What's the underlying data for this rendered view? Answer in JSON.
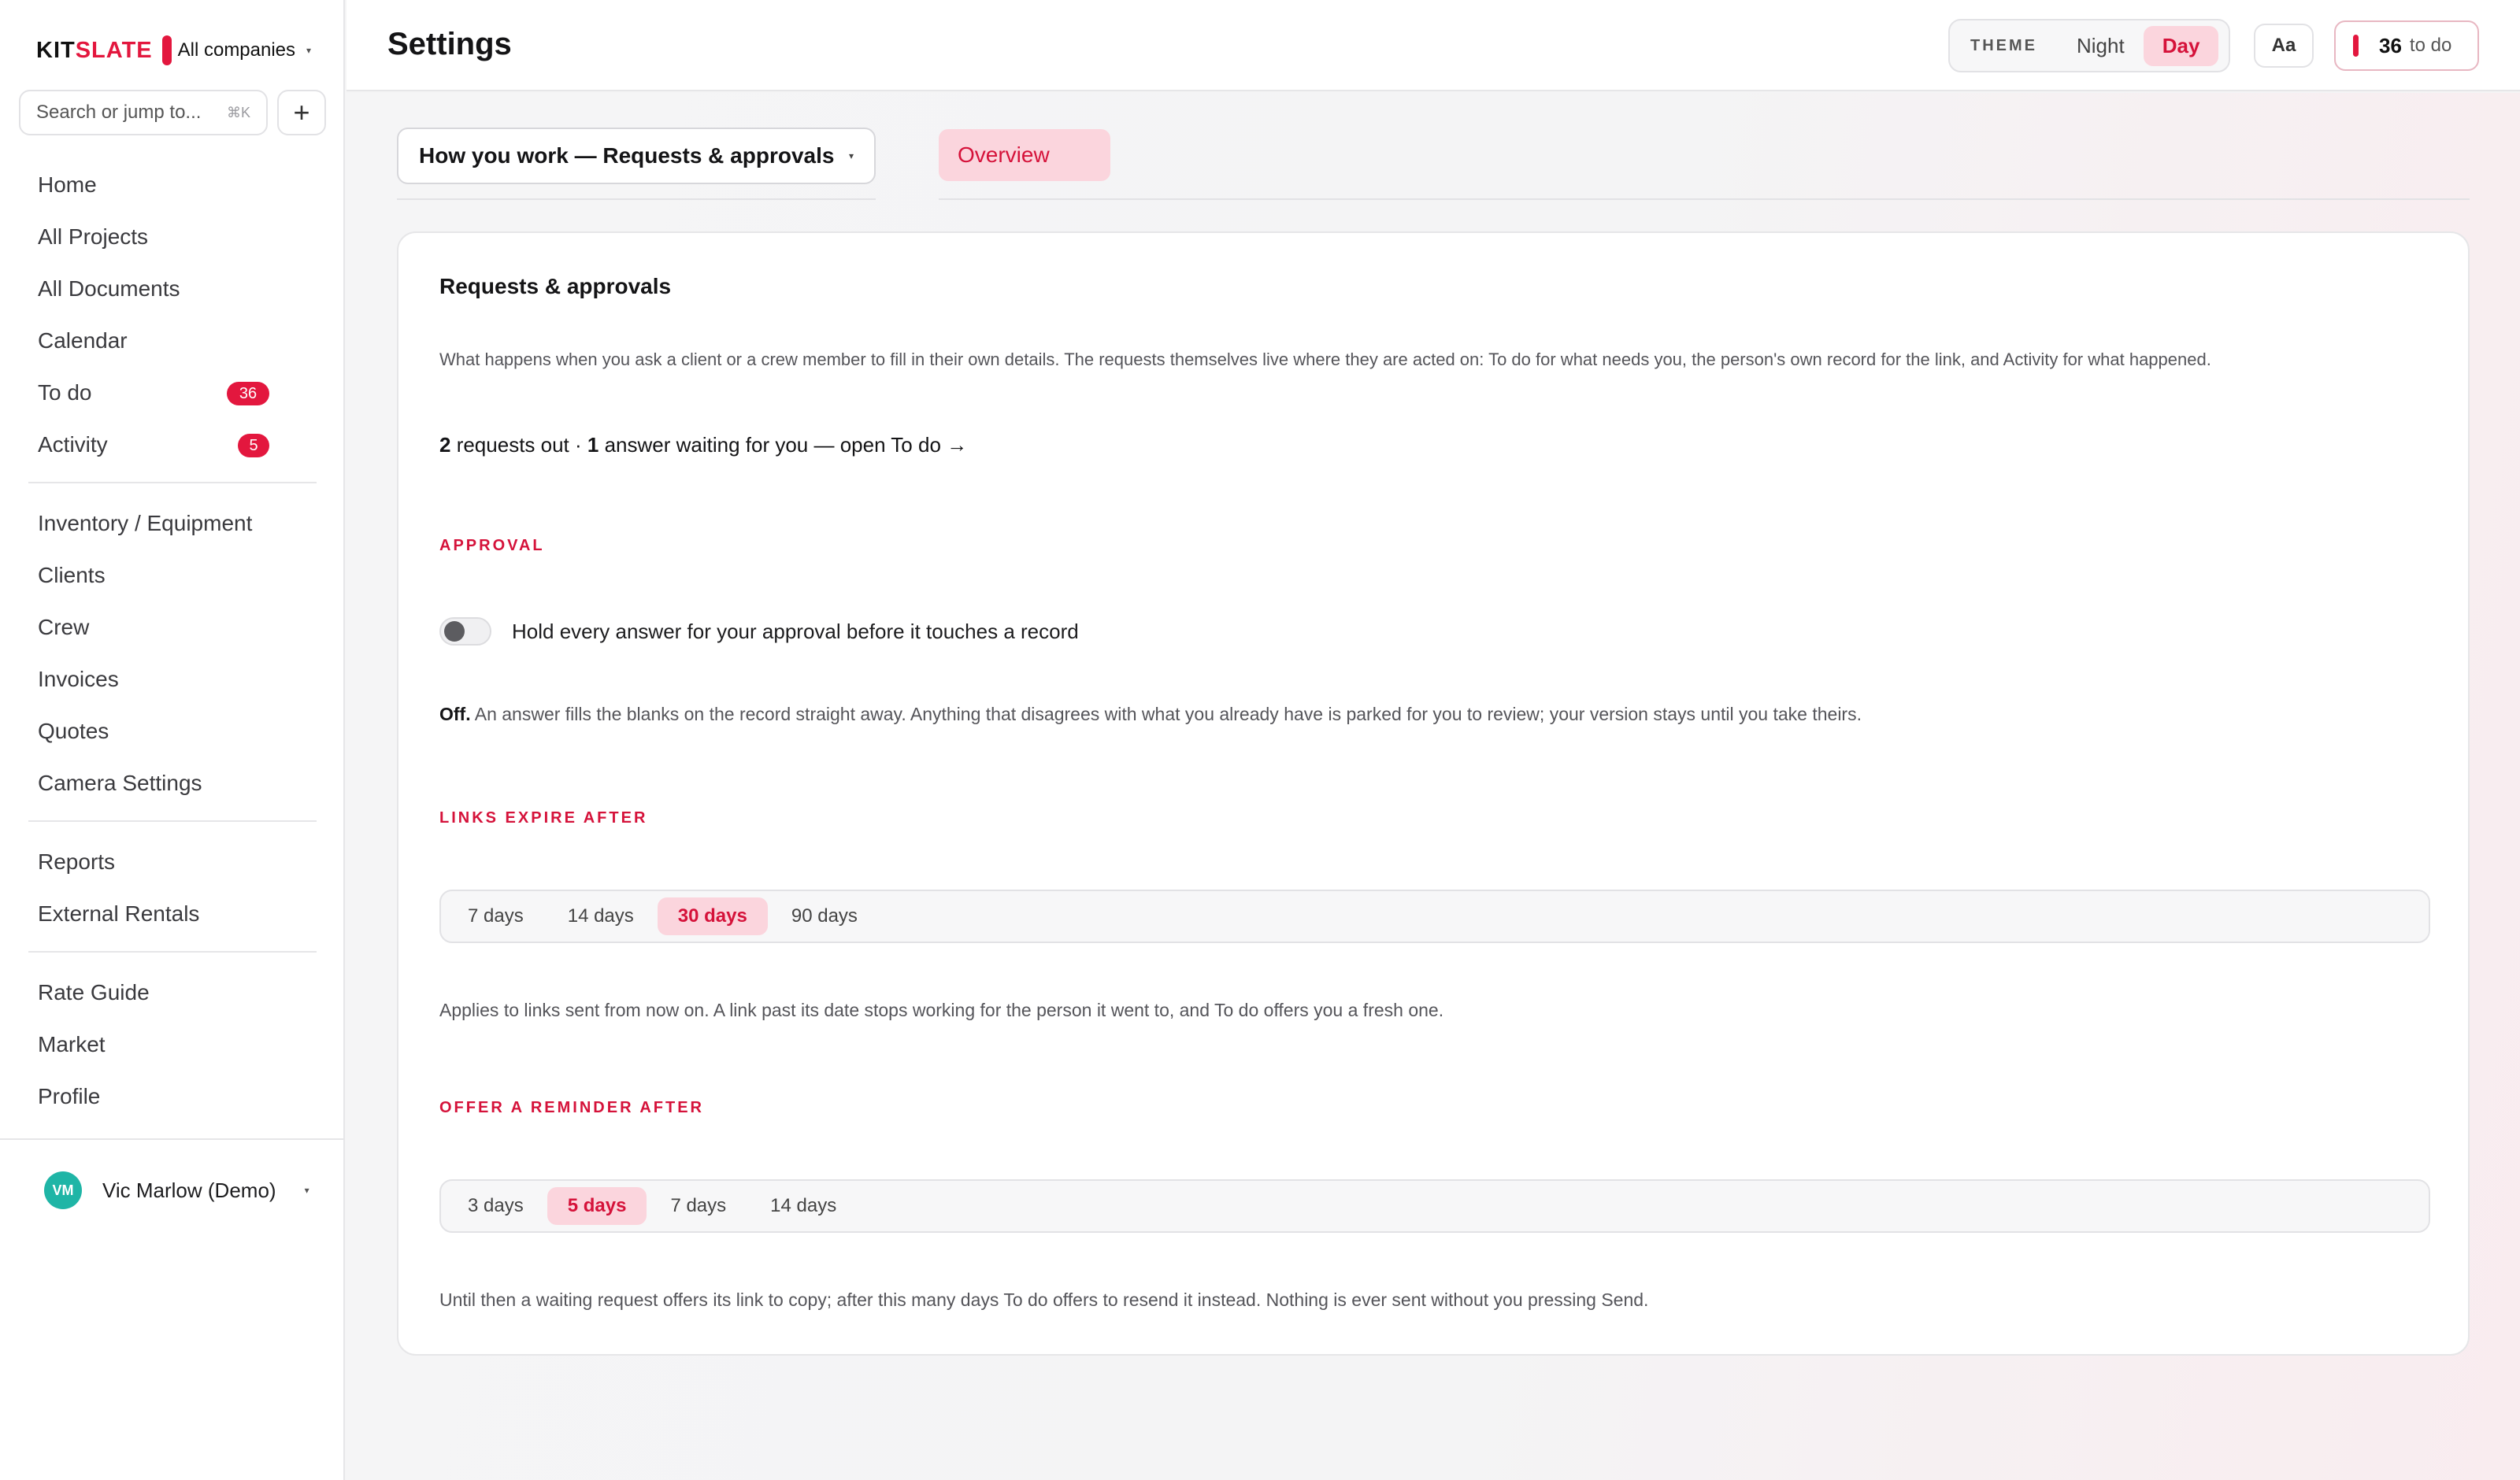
{
  "app": {
    "brand_kit": "KIT",
    "brand_slate": "SLATE",
    "company": "All companies",
    "company_caret": "▾"
  },
  "search": {
    "placeholder": "Search or jump to...",
    "shortcut": "⌘K",
    "add_label": "+"
  },
  "nav": {
    "group1": [
      {
        "label": "Home"
      },
      {
        "label": "All Projects"
      },
      {
        "label": "All Documents"
      },
      {
        "label": "Calendar"
      },
      {
        "label": "To do",
        "badge": "36"
      },
      {
        "label": "Activity",
        "badge": "5"
      }
    ],
    "group2": [
      {
        "label": "Inventory / Equipment"
      },
      {
        "label": "Clients"
      },
      {
        "label": "Crew"
      },
      {
        "label": "Invoices"
      },
      {
        "label": "Quotes"
      },
      {
        "label": "Camera Settings"
      }
    ],
    "group3": [
      {
        "label": "Reports"
      },
      {
        "label": "External Rentals"
      }
    ],
    "group4": [
      {
        "label": "Rate Guide"
      },
      {
        "label": "Market"
      },
      {
        "label": "Profile"
      }
    ]
  },
  "user": {
    "initials": "VM",
    "name": "Vic Marlow (Demo)",
    "caret": "▾"
  },
  "header": {
    "title": "Settings",
    "theme_label": "THEME",
    "theme_options": [
      "Night",
      "Day"
    ],
    "theme_selected": "Day",
    "font_button": "Aa",
    "todo_count": "36",
    "todo_label": "to do"
  },
  "section_select": {
    "value": "How you work — Requests & approvals",
    "caret": "▾"
  },
  "tabs": {
    "overview": "Overview"
  },
  "card": {
    "title": "Requests & approvals",
    "description": "What happens when you ask a client or a crew member to fill in their own details. The requests themselves live where they are acted on: To do for what needs you, the person's own record for the link, and Activity for what happened.",
    "summary": {
      "requests_count": "2",
      "requests_text": " requests out · ",
      "answers_count": "1",
      "answers_text": " answer waiting for you — open To do →"
    },
    "approval": {
      "label": "APPROVAL",
      "toggle_label": "Hold every answer for your approval before it touches a record",
      "toggle_on": false,
      "state_word": "Off.",
      "note": " An answer fills the blanks on the record straight away. Anything that disagrees with what you already have is parked for you to review; your version stays until you take theirs."
    },
    "links": {
      "label": "LINKS EXPIRE AFTER",
      "options": [
        "7 days",
        "14 days",
        "30 days",
        "90 days"
      ],
      "selected": "30 days",
      "note": "Applies to links sent from now on. A link past its date stops working for the person it went to, and To do offers you a fresh one."
    },
    "reminder": {
      "label": "OFFER A REMINDER AFTER",
      "options": [
        "3 days",
        "5 days",
        "7 days",
        "14 days"
      ],
      "selected": "5 days",
      "note": "Until then a waiting request offers its link to copy; after this many days To do offers to resend it instead. Nothing is ever sent without you pressing Send."
    }
  },
  "colors": {
    "accent": "#e3173e",
    "accent_soft": "#fbd5dd",
    "avatar": "#1fb5a6"
  }
}
